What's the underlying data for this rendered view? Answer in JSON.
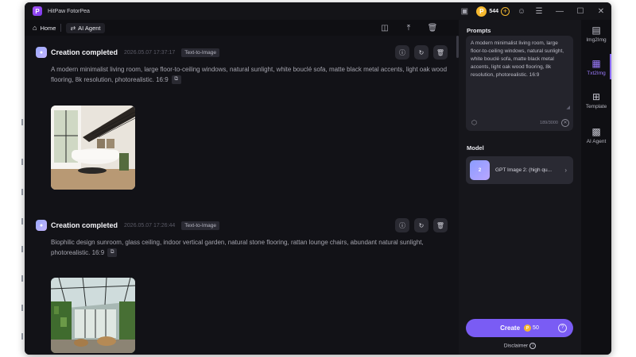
{
  "app": {
    "title": "HitPaw FotorPea",
    "logo_letter": "P"
  },
  "titlebar": {
    "coins": "544",
    "coin_symbol": "P",
    "add_symbol": "+"
  },
  "nav": {
    "home_label": "Home",
    "agent_label": "AI Agent"
  },
  "feed": {
    "items": [
      {
        "title": "Creation completed",
        "time": "2026.05.07  17:37:17",
        "badge": "Text-to-Image",
        "prompt": "A modern minimalist living room, large floor-to-ceiling windows, natural sunlight, white bouclé sofa, matte black metal accents, light oak wood flooring, 8k resolution, photorealistic. 16:9"
      },
      {
        "title": "Creation completed",
        "time": "2026.05.07  17:26:44",
        "badge": "Text-to-Image",
        "prompt": "Biophilic design sunroom, glass ceiling, indoor vertical garden, natural stone flooring, rattan lounge chairs, abundant natural sunlight, photorealistic. 16:9"
      }
    ]
  },
  "panel": {
    "prompts_label": "Prompts",
    "prompt_text": "A modern minimalist living room, large floor-to-ceiling windows, natural sunlight, white bouclé sofa, matte black metal accents, light oak wood flooring, 8k resolution, photorealistic. 16:9",
    "char_count": "189/3000",
    "model_label": "Model",
    "model_name": "GPT Image 2: (high qu...",
    "model_thumb_text": "2",
    "create_label": "Create",
    "create_cost": "50",
    "disclaimer": "Disclaimer"
  },
  "sidebar": {
    "items": [
      {
        "label": "Img2Img",
        "icon": "image-icon"
      },
      {
        "label": "Txt2Img",
        "icon": "text-image-icon",
        "active": true
      },
      {
        "label": "Template",
        "icon": "grid-icon"
      },
      {
        "label": "AI Agent",
        "icon": "chat-bot-icon"
      }
    ]
  },
  "colors": {
    "accent": "#7a5cf4",
    "coin": "#f5b82e",
    "background": "#0b0b0f",
    "panel": "#16161b"
  }
}
